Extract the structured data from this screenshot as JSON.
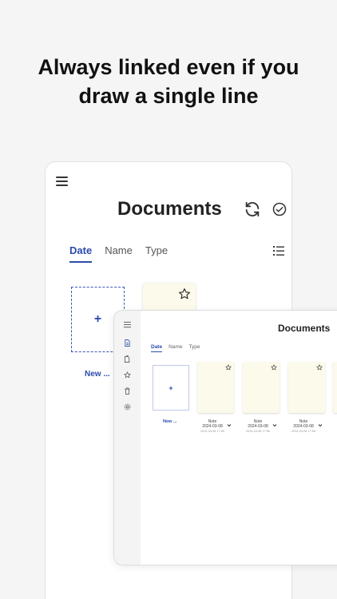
{
  "headline": {
    "line1": "Always linked even if you",
    "line2": "draw a single line"
  },
  "phone": {
    "title": "Documents",
    "tabs": [
      {
        "label": "Date",
        "active": true
      },
      {
        "label": "Name",
        "active": false
      },
      {
        "label": "Type",
        "active": false
      }
    ],
    "new_tile": {
      "symbol": "+",
      "label": "New ..."
    },
    "icons": [
      "menu-icon",
      "sync-icon",
      "check-circle-icon",
      "list-view-icon",
      "star-icon"
    ]
  },
  "tablet": {
    "title": "Documents",
    "tabs": [
      {
        "label": "Date",
        "active": true
      },
      {
        "label": "Name",
        "active": false
      },
      {
        "label": "Type",
        "active": false
      }
    ],
    "new_tile": {
      "symbol": "+",
      "label": "New ..."
    },
    "sidebar_icons": [
      "menu-icon",
      "document-icon",
      "documents-icon",
      "star-icon",
      "trash-icon",
      "settings-icon"
    ],
    "notes": [
      {
        "name": "Note",
        "date": "2024-03-08",
        "time": "2024-03-08 17:56"
      },
      {
        "name": "Note",
        "date": "2024-03-08",
        "time": "2024-03-08 17:56"
      },
      {
        "name": "Note",
        "date": "2024-03-08",
        "time": "2024-03-08 17:56"
      }
    ]
  },
  "colors": {
    "accent": "#2a4bab",
    "note_paper": "#fcfaea",
    "background": "#f5f5f5"
  }
}
